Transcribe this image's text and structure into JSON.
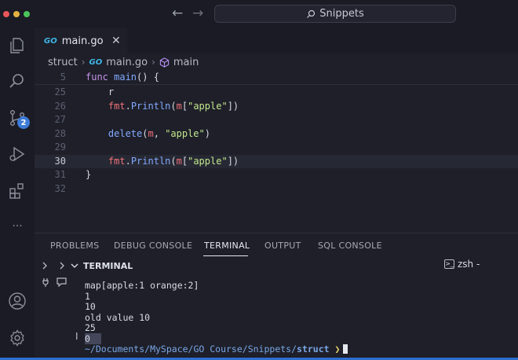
{
  "titlebar": {
    "search_label": "Snippets",
    "back_glyph": "←",
    "forward_glyph": "→"
  },
  "activity_bar": {
    "items": [
      "explorer-icon",
      "search-icon",
      "source-control-icon",
      "run-debug-icon",
      "extensions-icon",
      "more-icon",
      "account-icon",
      "settings-icon"
    ],
    "source_control_badge": "2",
    "more_glyph": "···"
  },
  "tab": {
    "icon_text": "GO",
    "label": "main.go",
    "close_glyph": "✕"
  },
  "breadcrumb": {
    "folder": "struct",
    "file": "main.go",
    "symbol": "main"
  },
  "editor": {
    "sticky": {
      "line": "5",
      "tokens": [
        [
          "kw",
          "func "
        ],
        [
          "fn",
          "main"
        ],
        [
          "plain",
          "() {"
        ]
      ]
    },
    "lines": [
      {
        "num": "25",
        "tokens": [
          [
            "plain",
            "    r"
          ]
        ]
      },
      {
        "num": "26",
        "tokens": [
          [
            "plain",
            "    "
          ],
          [
            "pkg",
            "fmt"
          ],
          [
            "plain",
            "."
          ],
          [
            "fn",
            "Println"
          ],
          [
            "plain",
            "("
          ],
          [
            "pkg",
            "m"
          ],
          [
            "plain",
            "["
          ],
          [
            "str",
            "\"apple\""
          ],
          [
            "plain",
            "])"
          ]
        ]
      },
      {
        "num": "27",
        "tokens": []
      },
      {
        "num": "28",
        "tokens": [
          [
            "plain",
            "    "
          ],
          [
            "fn",
            "delete"
          ],
          [
            "plain",
            "("
          ],
          [
            "pkg",
            "m"
          ],
          [
            "plain",
            ", "
          ],
          [
            "str",
            "\"apple\""
          ],
          [
            "plain",
            ")"
          ]
        ]
      },
      {
        "num": "29",
        "tokens": []
      },
      {
        "num": "30",
        "tokens": [
          [
            "plain",
            "    "
          ],
          [
            "pkg",
            "fmt"
          ],
          [
            "plain",
            "."
          ],
          [
            "fn",
            "Println"
          ],
          [
            "plain",
            "("
          ],
          [
            "pkg",
            "m"
          ],
          [
            "plain",
            "["
          ],
          [
            "str",
            "\"apple\""
          ],
          [
            "plain",
            "])"
          ]
        ],
        "active": true
      },
      {
        "num": "31",
        "tokens": [
          [
            "plain",
            "}"
          ]
        ]
      },
      {
        "num": "32",
        "tokens": []
      }
    ]
  },
  "panel": {
    "tabs": [
      "PROBLEMS",
      "DEBUG CONSOLE",
      "TERMINAL",
      "OUTPUT",
      "SQL CONSOLE"
    ],
    "active_tab": "TERMINAL",
    "terminal_title": "TERMINAL",
    "shell_label": "zsh -",
    "output": [
      "map[apple:1 orange:2]",
      "1",
      "10",
      "old value 10",
      "25",
      "0"
    ],
    "prompt_path": "~/Documents/MySpace/GO Course/Snippets/",
    "prompt_dir": "struct",
    "prompt_arrow": "❯"
  },
  "colors": {
    "accent": "#3d7bd8",
    "keyword": "#c792ea",
    "function": "#82aaff",
    "string": "#c3e88d",
    "identifier": "#f07178"
  }
}
